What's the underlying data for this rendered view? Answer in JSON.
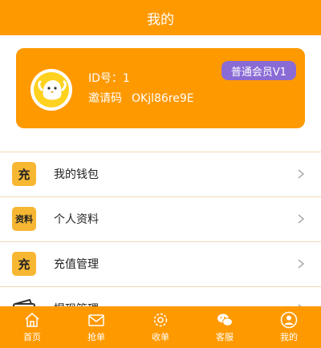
{
  "header": {
    "title": "我的"
  },
  "profile": {
    "id_text": "ID号：1",
    "invite_label": "邀请码",
    "invite_code": "OKjl86re9E",
    "member_level": "普通会员V1"
  },
  "menu": {
    "items": [
      {
        "icon_text": "充",
        "icon": "recharge-icon",
        "label": "我的钱包"
      },
      {
        "icon_text": "资料",
        "icon": "profile-icon",
        "label": "个人资料"
      },
      {
        "icon_text": "充",
        "icon": "recharge-icon",
        "label": "充值管理"
      },
      {
        "icon_text": "",
        "icon": "wallet-icon",
        "label": "提现管理"
      }
    ]
  },
  "tabbar": {
    "tabs": [
      {
        "label": "首页",
        "icon": "home-icon"
      },
      {
        "label": "抢单",
        "icon": "mail-icon"
      },
      {
        "label": "收单",
        "icon": "gear-icon"
      },
      {
        "label": "客服",
        "icon": "wechat-icon"
      },
      {
        "label": "我的",
        "icon": "user-icon"
      }
    ]
  },
  "colors": {
    "brand": "#ff9900",
    "badge": "#8a6bd6",
    "icon_bg": "#f7b733"
  }
}
